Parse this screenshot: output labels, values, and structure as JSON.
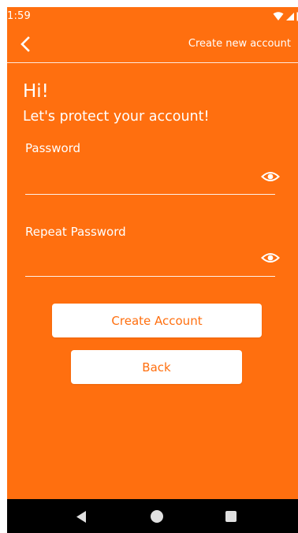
{
  "status_bar": {
    "time": "1:59",
    "icons": [
      "wifi-icon",
      "cell-signal-icon",
      "battery-icon"
    ]
  },
  "app_bar": {
    "back_icon": "chevron-left-icon",
    "title": "Create new account"
  },
  "content": {
    "greeting": "Hi!",
    "subtitle": "Let's protect your account!",
    "password": {
      "label": "Password",
      "value": "",
      "placeholder": "",
      "toggle_icon": "eye-icon"
    },
    "repeat_password": {
      "label": "Repeat Password",
      "value": "",
      "placeholder": "",
      "toggle_icon": "eye-icon"
    },
    "create_button": "Create Account",
    "back_button": "Back"
  },
  "nav_bar": {
    "items": [
      "nav-back-icon",
      "nav-home-icon",
      "nav-recents-icon"
    ]
  },
  "colors": {
    "background": "#ff6f0f",
    "text": "#ffffff",
    "button_bg": "#ffffff",
    "button_text": "#ff6f0f",
    "nav_bar": "#000000"
  }
}
